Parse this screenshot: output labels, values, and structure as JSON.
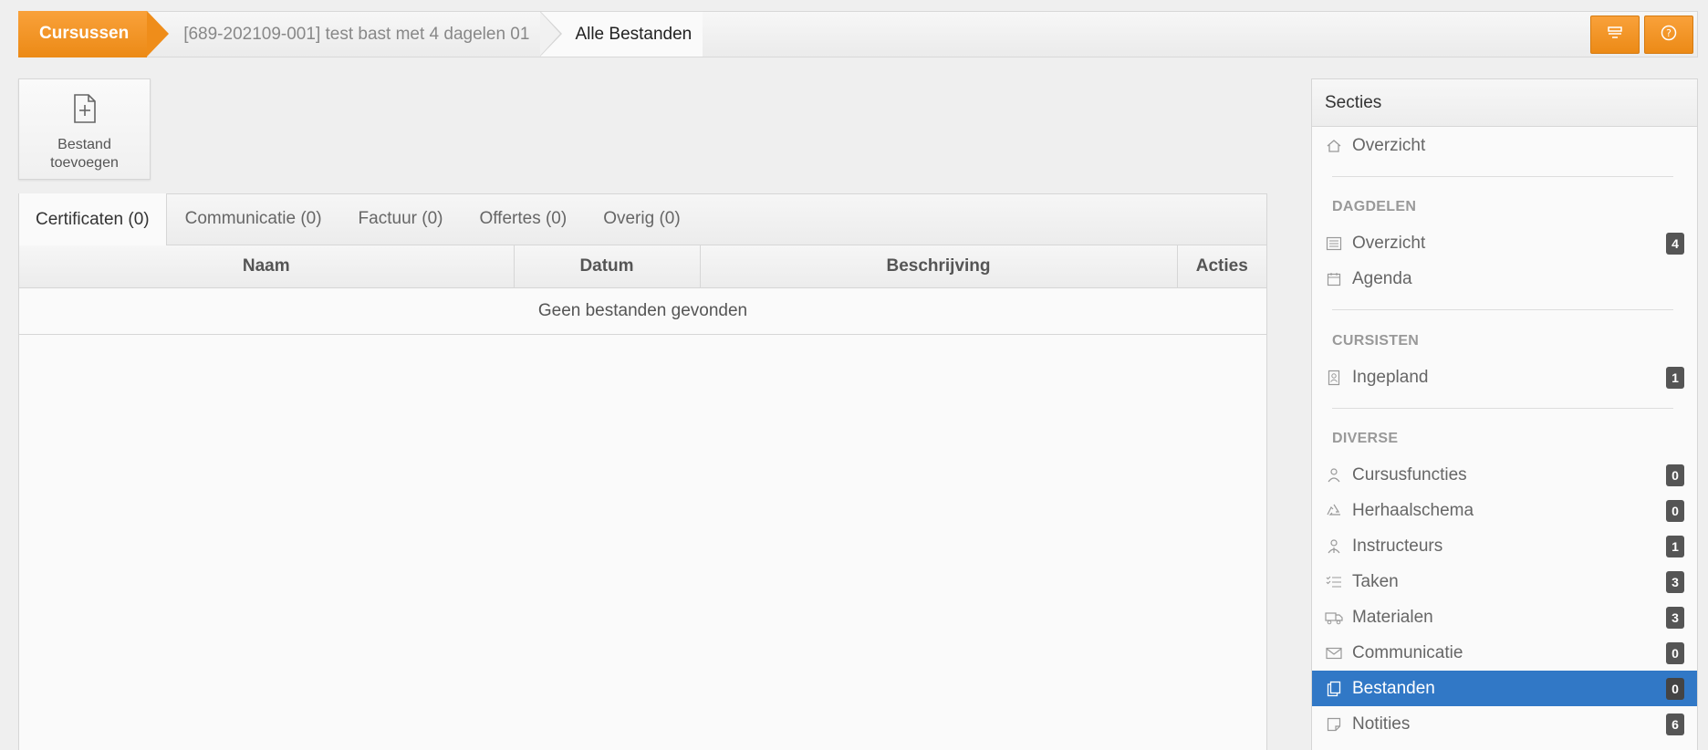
{
  "breadcrumb": {
    "home": "Cursussen",
    "course": "[689-202109-001] test bast met 4 dagelen 01",
    "current": "Alle Bestanden"
  },
  "topbar_buttons": [
    {
      "icon": "settings-panel-icon"
    },
    {
      "icon": "help-icon"
    }
  ],
  "add_file": {
    "label_line1": "Bestand",
    "label_line2": "toevoegen",
    "icon": "file-plus-icon"
  },
  "tabs": [
    {
      "label": "Certificaten (0)",
      "active": true
    },
    {
      "label": "Communicatie (0)"
    },
    {
      "label": "Factuur (0)"
    },
    {
      "label": "Offertes (0)"
    },
    {
      "label": "Overig (0)"
    }
  ],
  "table": {
    "columns": [
      "Naam",
      "Datum",
      "Beschrijving",
      "Acties"
    ],
    "empty_message": "Geen bestanden gevonden"
  },
  "sidebar": {
    "title": "Secties",
    "overview": {
      "label": "Overzicht",
      "icon": "home-icon"
    },
    "groups": {
      "dagdelen": "DAGDELEN",
      "cursisten": "CURSISTEN",
      "diverse": "DIVERSE"
    },
    "dagdelen_items": [
      {
        "label": "Overzicht",
        "badge": "4",
        "icon": "list-icon"
      },
      {
        "label": "Agenda",
        "icon": "calendar-icon"
      }
    ],
    "cursisten_items": [
      {
        "label": "Ingepland",
        "badge": "1",
        "icon": "id-badge-icon"
      }
    ],
    "diverse_items": [
      {
        "label": "Cursusfuncties",
        "badge": "0",
        "icon": "people-icon"
      },
      {
        "label": "Herhaalschema",
        "badge": "0",
        "icon": "recycle-icon"
      },
      {
        "label": "Instructeurs",
        "badge": "1",
        "icon": "instructor-icon"
      },
      {
        "label": "Taken",
        "badge": "3",
        "icon": "tasks-icon"
      },
      {
        "label": "Materialen",
        "badge": "3",
        "icon": "truck-icon"
      },
      {
        "label": "Communicatie",
        "badge": "0",
        "icon": "envelope-icon"
      },
      {
        "label": "Bestanden",
        "badge": "0",
        "icon": "files-icon",
        "active": true
      },
      {
        "label": "Notities",
        "badge": "6",
        "icon": "note-icon"
      }
    ]
  },
  "colors": {
    "accent_orange": "#ef8d1a",
    "active_blue": "#3178c6"
  }
}
